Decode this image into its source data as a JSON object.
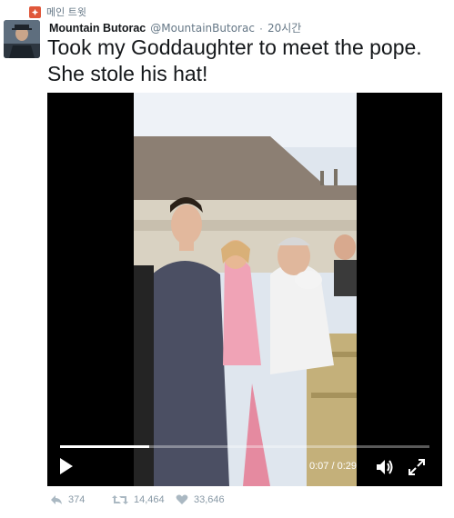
{
  "topbar": {
    "label": "메인 트윗",
    "icon": "moment-icon"
  },
  "tweet": {
    "name": "Mountain Butorac",
    "handle": "@MountainButorac",
    "separator": "·",
    "time": "20시간",
    "text": "Took my Goddaughter to meet the pope. She stole his hat!"
  },
  "video": {
    "timecode": "0:07 / 0:29",
    "progress_fraction": 0.241,
    "icons": [
      "play-icon",
      "volume-icon",
      "fullscreen-icon"
    ]
  },
  "actions": {
    "replies": "374",
    "retweets": "14,464",
    "likes": "33,646"
  },
  "colors": {
    "accent": "#e0573a",
    "muted": "#8899a6",
    "text": "#14171a"
  }
}
